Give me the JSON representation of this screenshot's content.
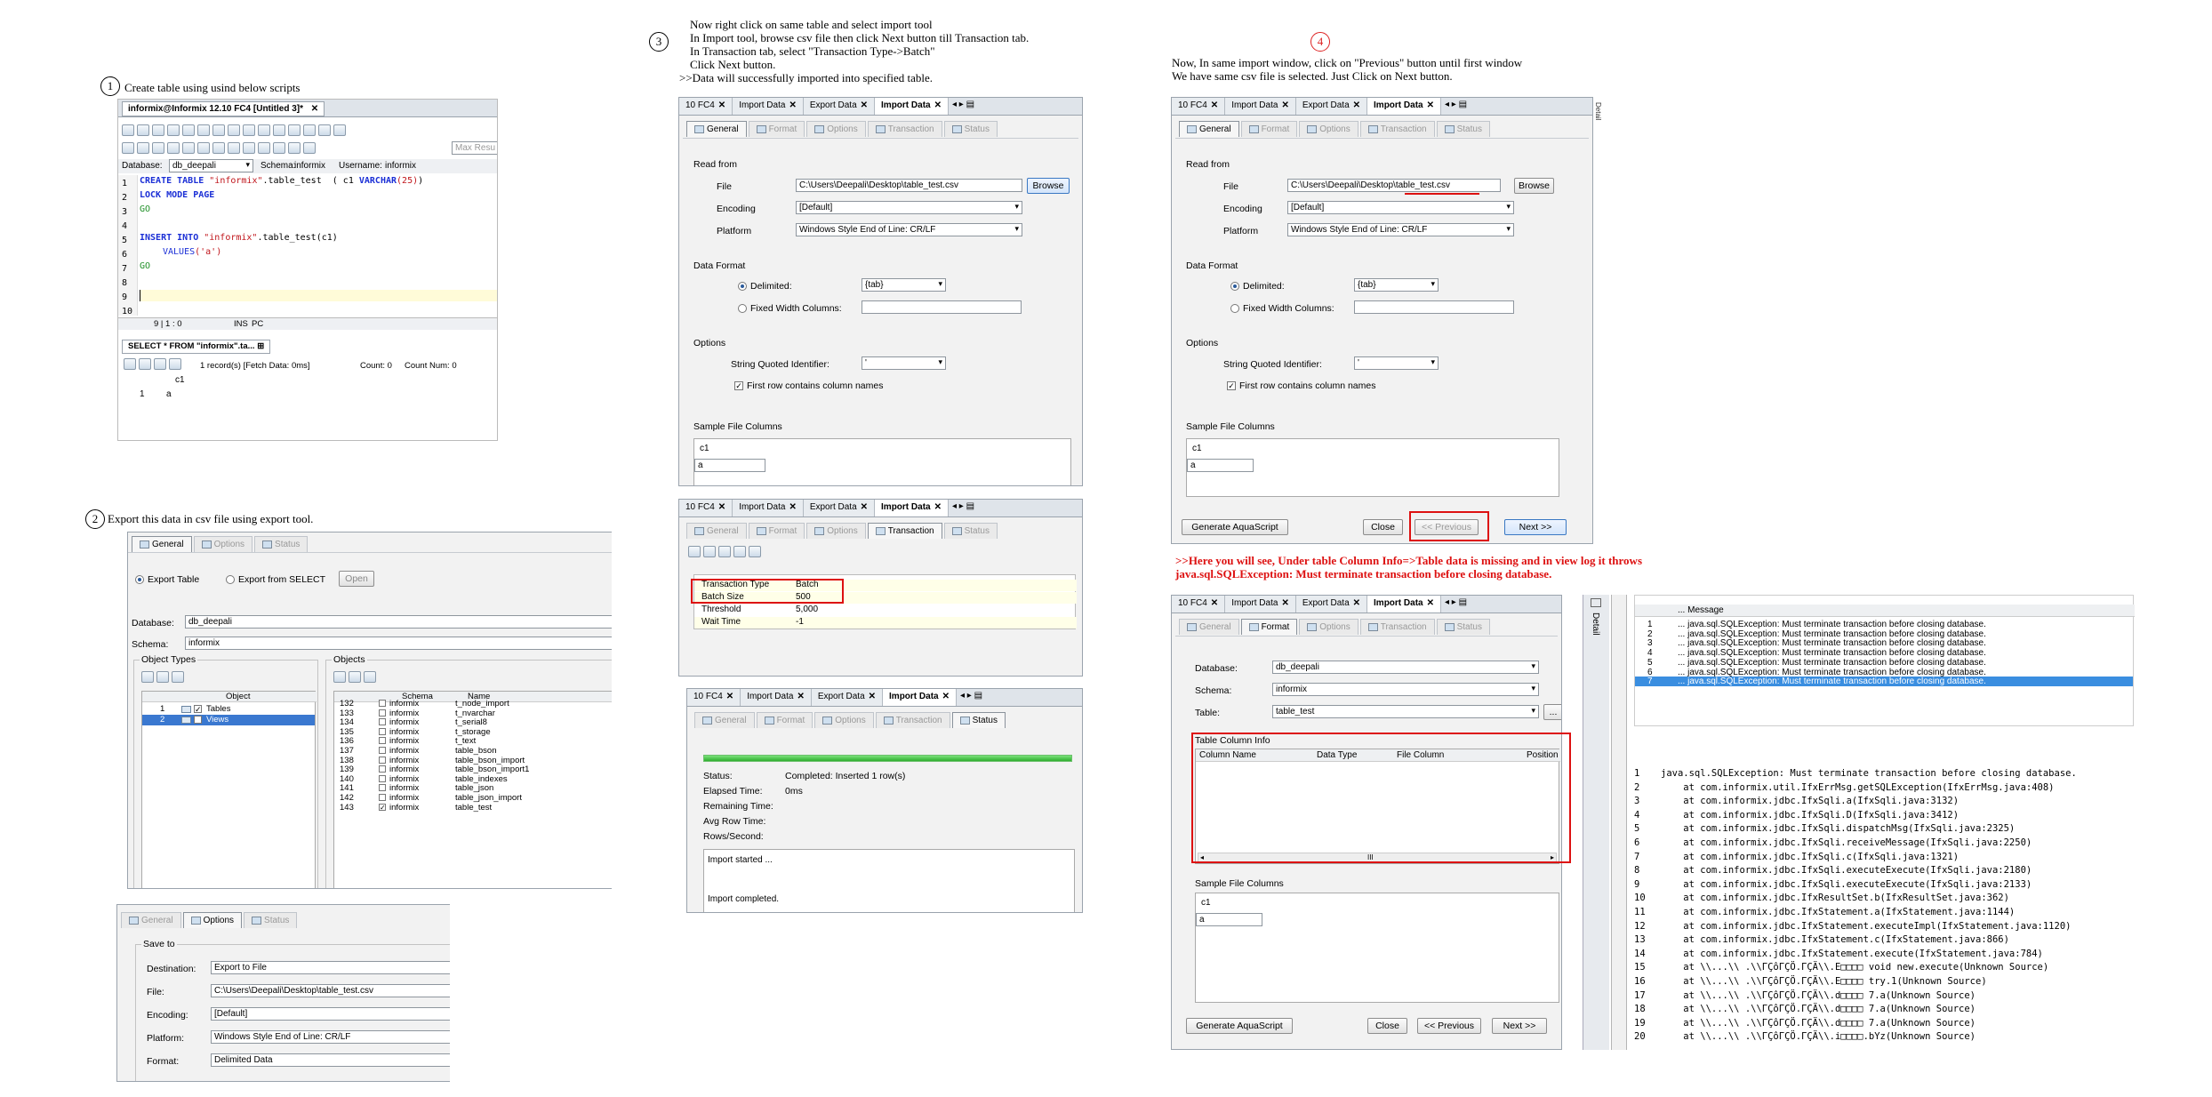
{
  "step1": {
    "num": "1",
    "text": "Create table using  usind below scripts",
    "window_tab": "informix@Informix 12.10 FC4 [Untitled 3]*",
    "database_label": "Database:",
    "database_value": "db_deepali",
    "schema_label": "Schema:",
    "schema_value": "informix",
    "username_label": "Username:",
    "username_value": "informix",
    "max_results": "Max Resu",
    "line_numbers": [
      "1",
      "2",
      "3",
      "4",
      "5",
      "6",
      "7",
      "8",
      "9",
      "10"
    ],
    "code": {
      "l1_kw": "CREATE TABLE ",
      "l1_str": "\"informix\"",
      "l1_rest": ".table_test  ( c1 ",
      "l1_kw2": "VARCHAR",
      "l1_num": "(25)",
      "l1_end": ")",
      "l2": "LOCK MODE PAGE",
      "l3": "GO",
      "l5_kw": "INSERT INTO ",
      "l5_str": "\"informix\"",
      "l5_rest": ".table_test(c1)",
      "l6_kw": "VALUES",
      "l6_str": "('a')",
      "l7": "GO"
    },
    "status_pos": "9 | 1 : 0",
    "status_ins": "INS",
    "status_pc": "PC",
    "result_tab": "SELECT * FROM \"informix\".ta...",
    "result_info": "1 record(s) [Fetch Data: 0ms]",
    "count_label": "Count: 0",
    "count_num": "Count Num: 0",
    "grid_header": "c1",
    "grid_row_num": "1",
    "grid_row_val": "a"
  },
  "step2": {
    "num": "2",
    "text": "Export this data in csv file using export tool.",
    "tabs": [
      "General",
      "Options",
      "Status"
    ],
    "export_table": "Export Table",
    "export_select": "Export from SELECT",
    "open_button": "Open",
    "database_label": "Database:",
    "database_value": "db_deepali",
    "schema_label": "Schema:",
    "schema_value": "informix",
    "object_types_label": "Object Types",
    "objects_label": "Objects",
    "object_col": "Object",
    "object_types": [
      {
        "n": "1",
        "name": "Tables"
      },
      {
        "n": "2",
        "name": "Views"
      }
    ],
    "schema_col": "Schema",
    "name_col": "Name",
    "objects": [
      {
        "n": "132",
        "schema": "informix",
        "name": "t_node_import"
      },
      {
        "n": "133",
        "schema": "informix",
        "name": "t_nvarchar"
      },
      {
        "n": "134",
        "schema": "informix",
        "name": "t_serial8"
      },
      {
        "n": "135",
        "schema": "informix",
        "name": "t_storage"
      },
      {
        "n": "136",
        "schema": "informix",
        "name": "t_text"
      },
      {
        "n": "137",
        "schema": "informix",
        "name": "table_bson"
      },
      {
        "n": "138",
        "schema": "informix",
        "name": "table_bson_import"
      },
      {
        "n": "139",
        "schema": "informix",
        "name": "table_bson_import1"
      },
      {
        "n": "140",
        "schema": "informix",
        "name": "table_indexes"
      },
      {
        "n": "141",
        "schema": "informix",
        "name": "table_json"
      },
      {
        "n": "142",
        "schema": "informix",
        "name": "table_json_import"
      },
      {
        "n": "143",
        "schema": "informix",
        "name": "table_test"
      }
    ],
    "options_tabs": [
      "General",
      "Options",
      "Status"
    ],
    "save_to": "Save to",
    "destination_label": "Destination:",
    "destination_value": "Export to File",
    "file_label": "File:",
    "file_value": "C:\\Users\\Deepali\\Desktop\\table_test.csv",
    "encoding_label": "Encoding:",
    "encoding_value": "[Default]",
    "platform_label": "Platform:",
    "platform_value": "Windows Style End of Line: CR/LF",
    "format_label": "Format:",
    "format_value": "Delimited Data"
  },
  "step3": {
    "num": "3",
    "lines": [
      "Now right click on same table and select import tool",
      "In Import tool, browse csv file then click Next button till Transaction tab.",
      "In Transaction tab, select \"Transaction Type->Batch\"",
      " Click Next button.",
      ">>Data will successfully imported into specified table."
    ],
    "editor_tabs": [
      "10 FC4",
      "Import Data",
      "Export Data",
      "Import Data"
    ],
    "wizard_tabs": [
      "General",
      "Format",
      "Options",
      "Transaction",
      "Status"
    ],
    "read_from": "Read from",
    "file_label": "File",
    "file_value": "C:\\Users\\Deepali\\Desktop\\table_test.csv",
    "browse_button": "Browse",
    "encoding_label": "Encoding",
    "encoding_value": "[Default]",
    "platform_label": "Platform",
    "platform_value": "Windows Style End of Line: CR/LF",
    "data_format": "Data Format",
    "delimited_label": "Delimited:",
    "delimited_value": "{tab}",
    "fixed_label": "Fixed Width Columns:",
    "options": "Options",
    "quoted_label": "String Quoted Identifier:",
    "quoted_value": "'",
    "first_row": "First row contains column names",
    "sample_cols": "Sample File Columns",
    "sample_header": "c1",
    "sample_val": "a",
    "transaction_type_label": "Transaction Type",
    "transaction_type_value": "Batch",
    "batch_size_label": "Batch Size",
    "batch_size_value": "500",
    "threshold_label": "Threshold",
    "threshold_value": "5,000",
    "wait_time_label": "Wait Time",
    "wait_time_value": "-1",
    "status_label": "Status:",
    "status_value": "Completed: Inserted 1 row(s)",
    "elapsed_label": "Elapsed Time:",
    "elapsed_value": "0ms",
    "remaining_label": "Remaining Time:",
    "avg_row_label": "Avg Row Time:",
    "rows_sec_label": "Rows/Second:",
    "log_start": "Import started ...",
    "log_end": "Import completed."
  },
  "step4": {
    "num": "4",
    "lines": [
      "Now, In same import window, click on \"Previous\" button until first window",
      "We have same csv file is selected. Just Click on Next button."
    ],
    "generate_button": "Generate AquaScript",
    "close_button": "Close",
    "prev_button": "<< Previous",
    "next_button": "Next >>",
    "note_line1": ">>Here you will see, Under table Column Info=>Table data is missing and in view log it throws",
    "note_line2": "java.sql.SQLException: Must terminate transaction before closing database.",
    "database_label": "Database:",
    "database_value": "db_deepali",
    "schema_label": "Schema:",
    "schema_value": "informix",
    "table_label": "Table:",
    "table_value": "table_test",
    "ellipsis_button": "...",
    "table_col_info": "Table Column Info",
    "col_headers": [
      "Column Name",
      "Data Type",
      "File Column",
      "Position"
    ],
    "scroll_grip": "III",
    "detail_label": "Detail",
    "side_label": "Detail",
    "message_header": "... Message",
    "messages": [
      {
        "n": "1",
        "text": "... java.sql.SQLException: Must terminate transaction before closing database."
      },
      {
        "n": "2",
        "text": "... java.sql.SQLException: Must terminate transaction before closing database."
      },
      {
        "n": "3",
        "text": "... java.sql.SQLException: Must terminate transaction before closing database."
      },
      {
        "n": "4",
        "text": "... java.sql.SQLException: Must terminate transaction before closing database."
      },
      {
        "n": "5",
        "text": "... java.sql.SQLException: Must terminate transaction before closing database."
      },
      {
        "n": "6",
        "text": "... java.sql.SQLException: Must terminate transaction before closing database."
      },
      {
        "n": "7",
        "text": "... java.sql.SQLException: Must terminate transaction before closing database."
      }
    ],
    "stack": [
      {
        "n": "1",
        "text": "java.sql.SQLException: Must terminate transaction before closing database."
      },
      {
        "n": "2",
        "text": "    at com.informix.util.IfxErrMsg.getSQLException(IfxErrMsg.java:408)"
      },
      {
        "n": "3",
        "text": "    at com.informix.jdbc.IfxSqli.a(IfxSqli.java:3132)"
      },
      {
        "n": "4",
        "text": "    at com.informix.jdbc.IfxSqli.D(IfxSqli.java:3412)"
      },
      {
        "n": "5",
        "text": "    at com.informix.jdbc.IfxSqli.dispatchMsg(IfxSqli.java:2325)"
      },
      {
        "n": "6",
        "text": "    at com.informix.jdbc.IfxSqli.receiveMessage(IfxSqli.java:2250)"
      },
      {
        "n": "7",
        "text": "    at com.informix.jdbc.IfxSqli.c(IfxSqli.java:1321)"
      },
      {
        "n": "8",
        "text": "    at com.informix.jdbc.IfxSqli.executeExecute(IfxSqli.java:2180)"
      },
      {
        "n": "9",
        "text": "    at com.informix.jdbc.IfxSqli.executeExecute(IfxSqli.java:2133)"
      },
      {
        "n": "10",
        "text": "    at com.informix.jdbc.IfxResultSet.b(IfxResultSet.java:362)"
      },
      {
        "n": "11",
        "text": "    at com.informix.jdbc.IfxStatement.a(IfxStatement.java:1144)"
      },
      {
        "n": "12",
        "text": "    at com.informix.jdbc.IfxStatement.executeImpl(IfxStatement.java:1120)"
      },
      {
        "n": "13",
        "text": "    at com.informix.jdbc.IfxStatement.c(IfxStatement.java:866)"
      },
      {
        "n": "14",
        "text": "    at com.informix.jdbc.IfxStatement.execute(IfxStatement.java:784)"
      },
      {
        "n": "15",
        "text": "    at \\\\...\\\\ .\\\\ΓÇôΓÇÖ.ΓÇÄ\\\\.E□□□□ void new.execute(Unknown Source)"
      },
      {
        "n": "16",
        "text": "    at \\\\...\\\\ .\\\\ΓÇôΓÇÖ.ΓÇÄ\\\\.E□□□□ try.1(Unknown Source)"
      },
      {
        "n": "17",
        "text": "    at \\\\...\\\\ .\\\\ΓÇôΓÇÖ.ΓÇÄ\\\\.d□□□□ 7.a(Unknown Source)"
      },
      {
        "n": "18",
        "text": "    at \\\\...\\\\ .\\\\ΓÇôΓÇÖ.ΓÇÄ\\\\.d□□□□ 7.a(Unknown Source)"
      },
      {
        "n": "19",
        "text": "    at \\\\...\\\\ .\\\\ΓÇôΓÇÖ.ΓÇÄ\\\\.d□□□□ 7.a(Unknown Source)"
      },
      {
        "n": "20",
        "text": "    at \\\\...\\\\ .\\\\ΓÇôΓÇÖ.ΓÇÄ\\\\.i□□□□.bYz(Unknown Source)"
      }
    ]
  },
  "colors": {
    "red": "#d11111",
    "accent": "#2a6fd6",
    "keyword": "#1b2fd6",
    "string": "#c0151b",
    "go": "#209028"
  }
}
